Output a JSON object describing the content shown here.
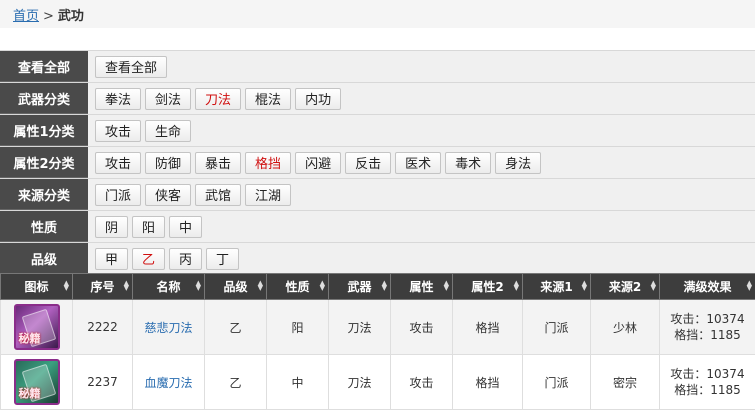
{
  "breadcrumb": {
    "home": "首页",
    "separator": ">",
    "current": "武功"
  },
  "filters": [
    {
      "label": "查看全部",
      "options": [
        {
          "text": "查看全部",
          "active": false
        }
      ]
    },
    {
      "label": "武器分类",
      "options": [
        {
          "text": "拳法",
          "active": false
        },
        {
          "text": "剑法",
          "active": false
        },
        {
          "text": "刀法",
          "active": true
        },
        {
          "text": "棍法",
          "active": false
        },
        {
          "text": "内功",
          "active": false
        }
      ]
    },
    {
      "label": "属性1分类",
      "options": [
        {
          "text": "攻击",
          "active": false
        },
        {
          "text": "生命",
          "active": false
        }
      ]
    },
    {
      "label": "属性2分类",
      "options": [
        {
          "text": "攻击",
          "active": false
        },
        {
          "text": "防御",
          "active": false
        },
        {
          "text": "暴击",
          "active": false
        },
        {
          "text": "格挡",
          "active": true
        },
        {
          "text": "闪避",
          "active": false
        },
        {
          "text": "反击",
          "active": false
        },
        {
          "text": "医术",
          "active": false
        },
        {
          "text": "毒术",
          "active": false
        },
        {
          "text": "身法",
          "active": false
        }
      ]
    },
    {
      "label": "来源分类",
      "options": [
        {
          "text": "门派",
          "active": false
        },
        {
          "text": "侠客",
          "active": false
        },
        {
          "text": "武馆",
          "active": false
        },
        {
          "text": "江湖",
          "active": false
        }
      ]
    },
    {
      "label": "性质",
      "options": [
        {
          "text": "阴",
          "active": false
        },
        {
          "text": "阳",
          "active": false
        },
        {
          "text": "中",
          "active": false
        }
      ]
    },
    {
      "label": "品级",
      "options": [
        {
          "text": "甲",
          "active": false
        },
        {
          "text": "乙",
          "active": true
        },
        {
          "text": "丙",
          "active": false
        },
        {
          "text": "丁",
          "active": false
        }
      ]
    }
  ],
  "table": {
    "columns": [
      "图标",
      "序号",
      "名称",
      "品级",
      "性质",
      "武器",
      "属性",
      "属性2",
      "来源1",
      "来源2",
      "满级效果"
    ],
    "rows": [
      {
        "icon": "purple-scroll-icon",
        "icon_text": "秘籍",
        "id": "2222",
        "name": "慈悲刀法",
        "grade": "乙",
        "nature": "阳",
        "weapon": "刀法",
        "attr": "攻击",
        "attr2": "格挡",
        "source1": "门派",
        "source2": "少林",
        "effect_line1": "攻击：10374",
        "effect_line2": "格挡：1185"
      },
      {
        "icon": "green-scroll-icon",
        "icon_text": "秘籍",
        "id": "2237",
        "name": "血魔刀法",
        "grade": "乙",
        "nature": "中",
        "weapon": "刀法",
        "attr": "攻击",
        "attr2": "格挡",
        "source1": "门派",
        "source2": "密宗",
        "effect_line1": "攻击：10374",
        "effect_line2": "格挡：1185"
      }
    ]
  },
  "colors": {
    "active": "#d01010",
    "link": "#2a6db0",
    "label_bg": "#4a4a4a"
  }
}
